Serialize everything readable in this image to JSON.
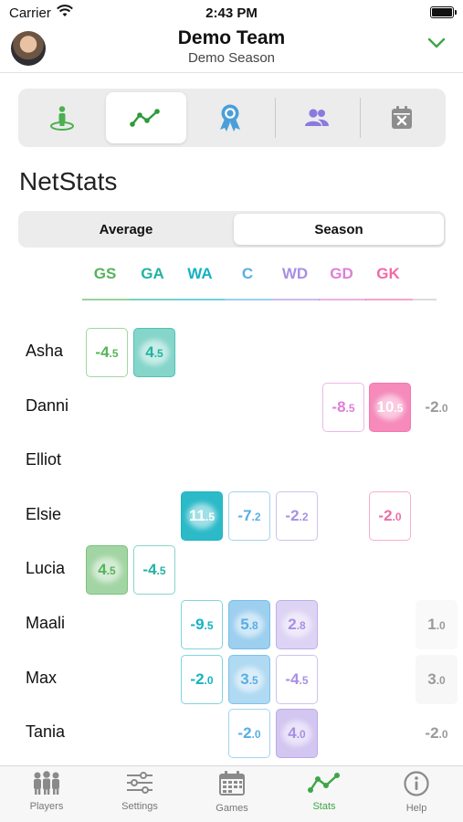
{
  "status_bar": {
    "carrier": "Carrier",
    "time": "2:43 PM"
  },
  "header": {
    "team": "Demo Team",
    "season": "Demo Season"
  },
  "section_title": "NetStats",
  "toggle": {
    "options": [
      "Average",
      "Season"
    ],
    "selected": "Season"
  },
  "positions": [
    {
      "code": "GS",
      "color": "#57b35a"
    },
    {
      "code": "GA",
      "color": "#22b3a0"
    },
    {
      "code": "WA",
      "color": "#15b2c2"
    },
    {
      "code": "C",
      "color": "#58aee3"
    },
    {
      "code": "WD",
      "color": "#a88fe3"
    },
    {
      "code": "GD",
      "color": "#dd7fd8"
    },
    {
      "code": "GK",
      "color": "#f26aa8"
    }
  ],
  "players": [
    {
      "name": "Asha",
      "cells": [
        {
          "col": 0,
          "whole": "-4",
          "dec": ".5",
          "fill": 0.0
        },
        {
          "col": 1,
          "whole": "4",
          "dec": ".5",
          "fill": 0.55
        }
      ]
    },
    {
      "name": "Danni",
      "cells": [
        {
          "col": 5,
          "whole": "-8",
          "dec": ".5",
          "fill": 0.0
        },
        {
          "col": 6,
          "whole": "10",
          "dec": ".5",
          "fill": 0.85
        },
        {
          "col": 7,
          "whole": "-2",
          "dec": ".0",
          "fill": 0.0
        }
      ]
    },
    {
      "name": "Elliot",
      "cells": []
    },
    {
      "name": "Elsie",
      "cells": [
        {
          "col": 2,
          "whole": "11",
          "dec": ".5",
          "fill": 1.0
        },
        {
          "col": 3,
          "whole": "-7",
          "dec": ".2",
          "fill": 0.0
        },
        {
          "col": 4,
          "whole": "-2",
          "dec": ".2",
          "fill": 0.0
        },
        {
          "col": 6,
          "whole": "-2",
          "dec": ".0",
          "fill": 0.0
        }
      ]
    },
    {
      "name": "Lucia",
      "cells": [
        {
          "col": 0,
          "whole": "4",
          "dec": ".5",
          "fill": 0.55
        },
        {
          "col": 1,
          "whole": "-4",
          "dec": ".5",
          "fill": 0.0
        }
      ]
    },
    {
      "name": "Maali",
      "cells": [
        {
          "col": 2,
          "whole": "-9",
          "dec": ".5",
          "fill": 0.0
        },
        {
          "col": 3,
          "whole": "5",
          "dec": ".8",
          "fill": 0.6
        },
        {
          "col": 4,
          "whole": "2",
          "dec": ".8",
          "fill": 0.35
        },
        {
          "col": 7,
          "whole": "1",
          "dec": ".0",
          "fill": 0.1
        }
      ]
    },
    {
      "name": "Max",
      "cells": [
        {
          "col": 2,
          "whole": "-2",
          "dec": ".0",
          "fill": 0.0
        },
        {
          "col": 3,
          "whole": "3",
          "dec": ".5",
          "fill": 0.45
        },
        {
          "col": 4,
          "whole": "-4",
          "dec": ".5",
          "fill": 0.0
        },
        {
          "col": 7,
          "whole": "3",
          "dec": ".0",
          "fill": 0.15
        }
      ]
    },
    {
      "name": "Tania",
      "cells": [
        {
          "col": 3,
          "whole": "-2",
          "dec": ".0",
          "fill": 0.0
        },
        {
          "col": 4,
          "whole": "4",
          "dec": ".0",
          "fill": 0.5
        },
        {
          "col": 7,
          "whole": "-2",
          "dec": ".0",
          "fill": 0.0
        }
      ]
    }
  ],
  "nav": {
    "items": [
      {
        "label": "Players",
        "icon": "players-icon"
      },
      {
        "label": "Settings",
        "icon": "settings-icon"
      },
      {
        "label": "Games",
        "icon": "games-icon"
      },
      {
        "label": "Stats",
        "icon": "stats-icon"
      },
      {
        "label": "Help",
        "icon": "help-icon"
      }
    ],
    "active": "Stats"
  }
}
